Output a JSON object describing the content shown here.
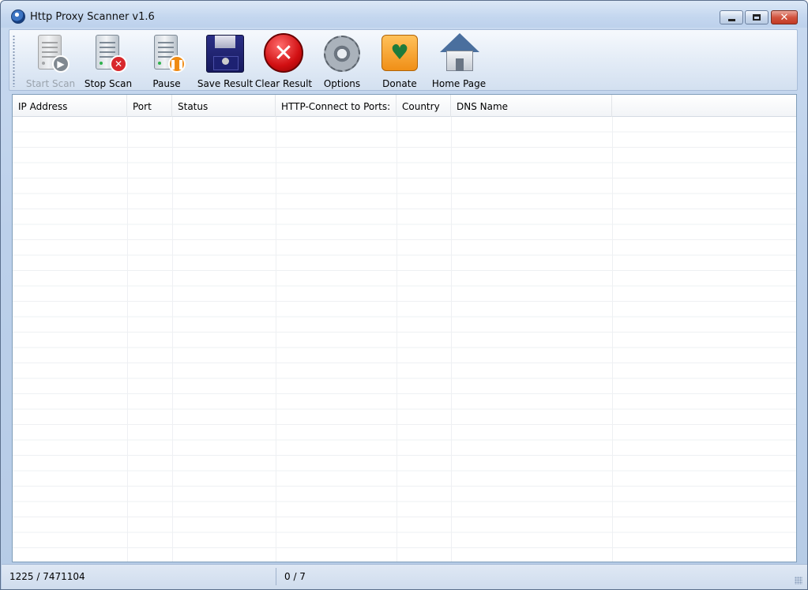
{
  "window": {
    "title": "Http Proxy Scanner v1.6"
  },
  "toolbar": {
    "buttons": [
      {
        "label": "Start Scan",
        "icon": "start-scan-icon",
        "enabled": false
      },
      {
        "label": "Stop Scan",
        "icon": "stop-scan-icon",
        "enabled": true
      },
      {
        "label": "Pause",
        "icon": "pause-icon",
        "enabled": true
      },
      {
        "label": "Save Result",
        "icon": "floppy-disk-icon",
        "enabled": true
      },
      {
        "label": "Clear Result",
        "icon": "clear-icon",
        "enabled": true
      },
      {
        "label": "Options",
        "icon": "gear-icon",
        "enabled": true
      },
      {
        "label": "Donate",
        "icon": "donate-icon",
        "enabled": true
      },
      {
        "label": "Home Page",
        "icon": "home-icon",
        "enabled": true
      }
    ]
  },
  "table": {
    "columns": [
      "IP Address",
      "Port",
      "Status",
      "HTTP-Connect to Ports:",
      "Country",
      "DNS Name"
    ],
    "rows": []
  },
  "status": {
    "progress": "1225 / 7471104",
    "found": "0 / 7"
  },
  "colors": {
    "frame": "#bcd0ea",
    "close_button": "#d2543f",
    "grid_line": "#eef0f3"
  }
}
